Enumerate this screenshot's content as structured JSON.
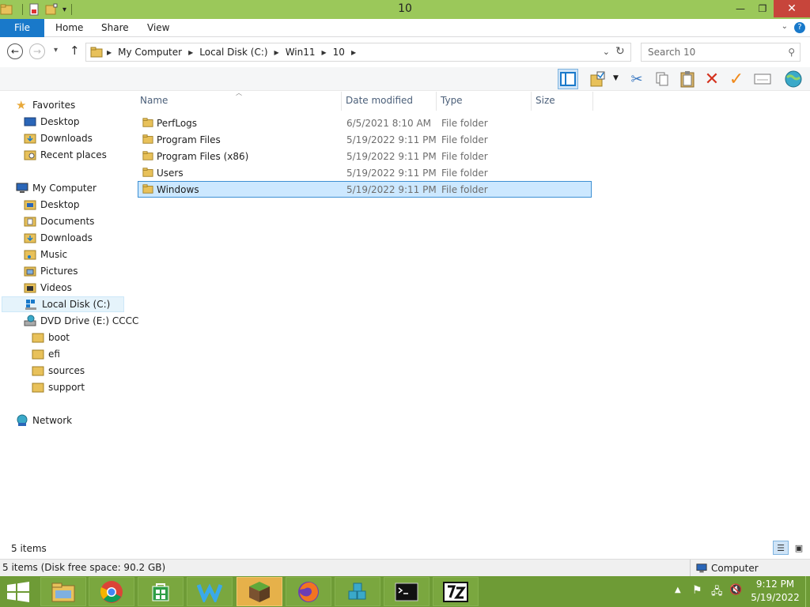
{
  "window": {
    "title": "10"
  },
  "ribbon": {
    "tabs": [
      "File",
      "Home",
      "Share",
      "View"
    ]
  },
  "address": {
    "crumbs": [
      "My Computer",
      "Local Disk (C:)",
      "Win11",
      "10"
    ]
  },
  "search": {
    "placeholder": "Search 10"
  },
  "navpane": {
    "favorites": {
      "label": "Favorites",
      "items": [
        "Desktop",
        "Downloads",
        "Recent places"
      ]
    },
    "computer": {
      "label": "My Computer",
      "items": [
        "Desktop",
        "Documents",
        "Downloads",
        "Music",
        "Pictures",
        "Videos",
        "Local Disk (C:)",
        "DVD Drive (E:) CCCC"
      ]
    },
    "dvd_children": [
      "boot",
      "efi",
      "sources",
      "support"
    ],
    "network": {
      "label": "Network"
    }
  },
  "columns": {
    "name": "Name",
    "date": "Date modified",
    "type": "Type",
    "size": "Size"
  },
  "files": [
    {
      "name": "PerfLogs",
      "date": "6/5/2021 8:10 AM",
      "type": "File folder"
    },
    {
      "name": "Program Files",
      "date": "5/19/2022 9:11 PM",
      "type": "File folder"
    },
    {
      "name": "Program Files (x86)",
      "date": "5/19/2022 9:11 PM",
      "type": "File folder"
    },
    {
      "name": "Users",
      "date": "5/19/2022 9:11 PM",
      "type": "File folder"
    },
    {
      "name": "Windows",
      "date": "5/19/2022 9:11 PM",
      "type": "File folder"
    }
  ],
  "status": {
    "item_count": "5 items",
    "details": "5 items (Disk free space: 90.2 GB)",
    "location": "Computer"
  },
  "taskbar": {
    "time": "9:12 PM",
    "date": "5/19/2022",
    "active_app": "minecraft"
  },
  "colors": {
    "titlebar": "#9bc85a",
    "taskbar": "#6e9b36",
    "file_tab": "#1979ca",
    "selection": "#cce8ff",
    "folder": "#e8c15a"
  }
}
